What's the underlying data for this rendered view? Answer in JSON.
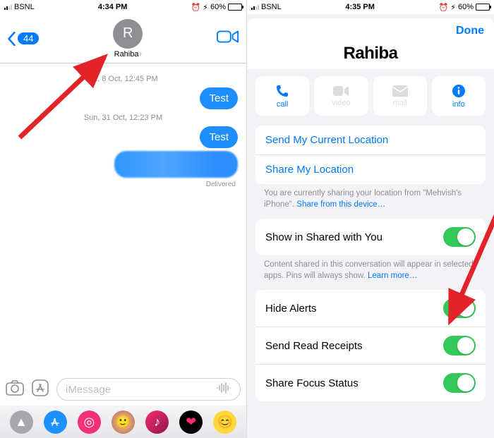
{
  "left": {
    "status": {
      "carrier": "BSNL",
      "time": "4:34 PM",
      "battery_pct": "60%",
      "alarm": "⏰",
      "bat_icon": "🔋"
    },
    "back_count": "44",
    "avatar_initial": "R",
    "contact_name": "Rahiba",
    "ts1": "Fri, 8 Oct, 12:45 PM",
    "bubble1": "Test",
    "ts2": "Sun, 31 Oct, 12:23 PM",
    "bubble2": "Test",
    "delivered": "Delivered",
    "placeholder": "iMessage"
  },
  "right": {
    "status": {
      "carrier": "BSNL",
      "time": "4:35 PM",
      "battery_pct": "60%"
    },
    "done": "Done",
    "title": "Rahiba",
    "actions": {
      "call": "call",
      "video": "video",
      "mail": "mail",
      "info": "info"
    },
    "send_location": "Send My Current Location",
    "share_location": "Share My Location",
    "location_footer_a": "You are currently sharing your location from \"Mehvish's iPhone\". ",
    "location_footer_link": "Share from this device…",
    "shared_with_you": "Show in Shared with You",
    "shared_footer_a": "Content shared in this conversation will appear in selected apps. Pins will always show. ",
    "shared_footer_link": "Learn more…",
    "hide_alerts": "Hide Alerts",
    "read_receipts": "Send Read Receipts",
    "focus_status": "Share Focus Status"
  },
  "colors": {
    "accent": "#007aff",
    "toggle_on": "#34c759",
    "arrow": "#e3232a"
  }
}
